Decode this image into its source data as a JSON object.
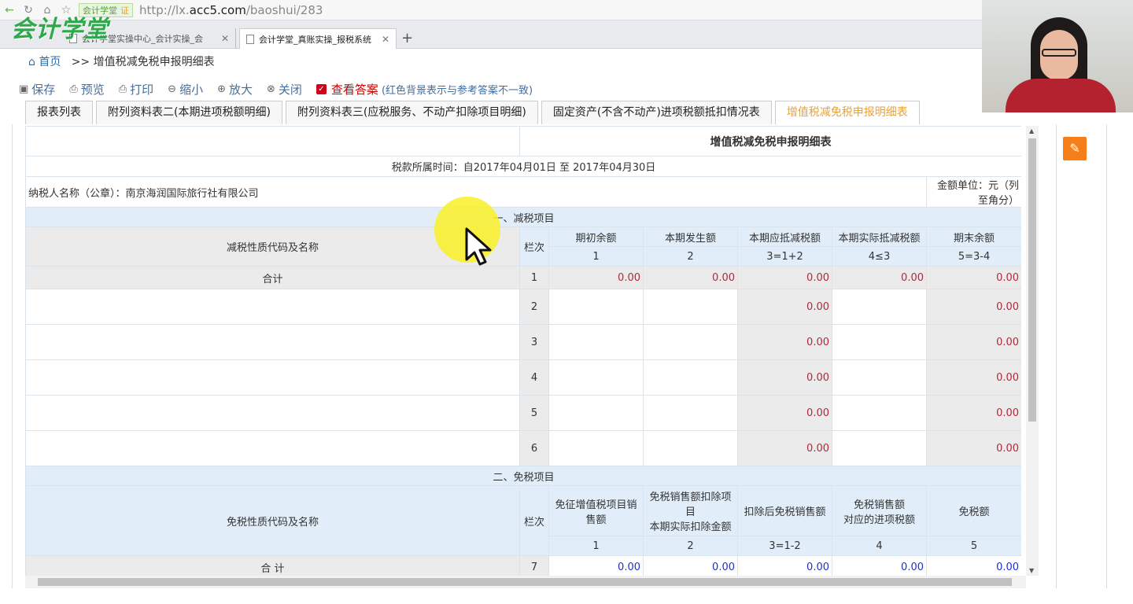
{
  "browser": {
    "badge": "会计学堂",
    "badge_cert": "证",
    "url_prefix": "http://lx.",
    "url_domain": "acc5.com",
    "url_path": "/baoshui/283",
    "tabs": [
      {
        "label": "会计学堂实操中心_会计实操_会"
      },
      {
        "label": "会计学堂_真账实操_报税系统"
      }
    ],
    "logo": "会计学堂"
  },
  "breadcrumb": {
    "home": "首页",
    "current": ">> 增值税减免税申报明细表"
  },
  "toolbar": {
    "save": "保存",
    "preview": "预览",
    "print": "打印",
    "zoom_out": "缩小",
    "zoom_in": "放大",
    "close": "关闭",
    "answer": "查看答案",
    "answer_note": "(红色背景表示与参考答案不一致)"
  },
  "form_tabs": [
    "报表列表",
    "附列资料表二(本期进项税额明细)",
    "附列资料表三(应税服务、不动产扣除项目明细)",
    "固定资产(不含不动产)进项税额抵扣情况表",
    "增值税减免税申报明细表"
  ],
  "sheet": {
    "title": "增值税减免税申报明细表",
    "period": "税款所属时间：自2017年04月01日 至 2017年04月30日",
    "taxpayer": "纳税人名称（公章）：南京海润国际旅行社有限公司",
    "unit": "金额单位：元（列至角分）",
    "section1": "一、减税项目",
    "s1_header": {
      "name": "减税性质代码及名称",
      "col": "栏次",
      "cols": [
        "期初余额",
        "本期发生额",
        "本期应抵减税额",
        "本期实际抵减税额",
        "期末余额"
      ],
      "nums": [
        "1",
        "2",
        "3=1+2",
        "4≤3",
        "5=3-4"
      ]
    },
    "s1_total": {
      "label": "合计",
      "line": "1",
      "values": [
        "0.00",
        "0.00",
        "0.00",
        "0.00",
        "0.00"
      ]
    },
    "s1_rows": [
      {
        "line": "2",
        "c3": "0.00",
        "c5": "0.00"
      },
      {
        "line": "3",
        "c3": "0.00",
        "c5": "0.00"
      },
      {
        "line": "4",
        "c3": "0.00",
        "c5": "0.00"
      },
      {
        "line": "5",
        "c3": "0.00",
        "c5": "0.00"
      },
      {
        "line": "6",
        "c3": "0.00",
        "c5": "0.00"
      }
    ],
    "section2": "二、免税项目",
    "s2_header": {
      "name": "免税性质代码及名称",
      "col": "栏次",
      "c1": "免征增值税项目销售额",
      "c2a": "免税销售额扣除项目",
      "c2b": "本期实际扣除金额",
      "c3": "扣除后免税销售额",
      "c4a": "免税销售额",
      "c4b": "对应的进项税额",
      "c5": "免税额",
      "nums": [
        "1",
        "2",
        "3=1-2",
        "4",
        "5"
      ]
    },
    "s2_total": {
      "label": "合 计",
      "line": "7",
      "values": [
        "0.00",
        "0.00",
        "0.00",
        "0.00",
        "0.00"
      ]
    }
  },
  "colors": {
    "accent_orange": "#f57e18",
    "section_bg": "#e1eef9",
    "red_value": "#b0283c",
    "blue_value": "#1f2fd3",
    "active_tab": "#e8a23d"
  }
}
